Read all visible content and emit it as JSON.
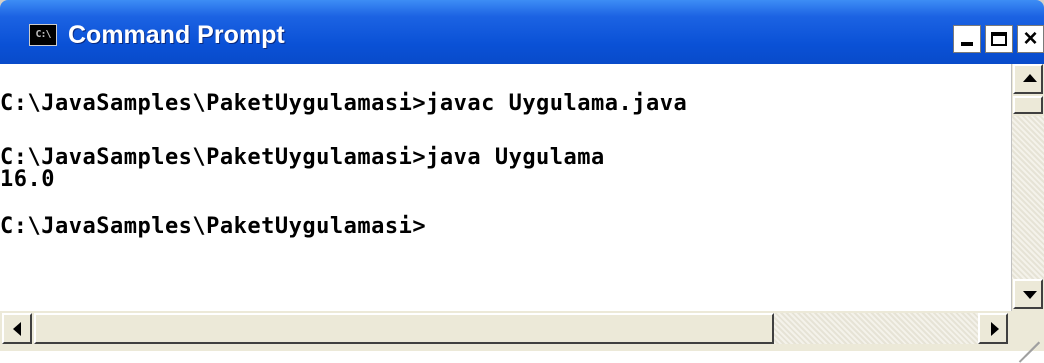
{
  "window": {
    "title": "Command Prompt",
    "icon_text": "C:\\",
    "icon_name": "cmd-icon",
    "buttons": {
      "minimize": "minimize-icon",
      "maximize": "maximize-icon",
      "close": "×"
    }
  },
  "console": {
    "lines": [
      "C:\\JavaSamples\\PaketUygulamasi>javac Uygulama.java",
      "",
      "C:\\JavaSamples\\PaketUygulamasi>java Uygulama",
      "16.0",
      "",
      "C:\\JavaSamples\\PaketUygulamasi>"
    ],
    "background": "#ffffff",
    "foreground": "#000000"
  },
  "colors": {
    "titlebar": "#0a51d6",
    "title_text": "#ffffff",
    "frame": "#d4d0c8"
  }
}
